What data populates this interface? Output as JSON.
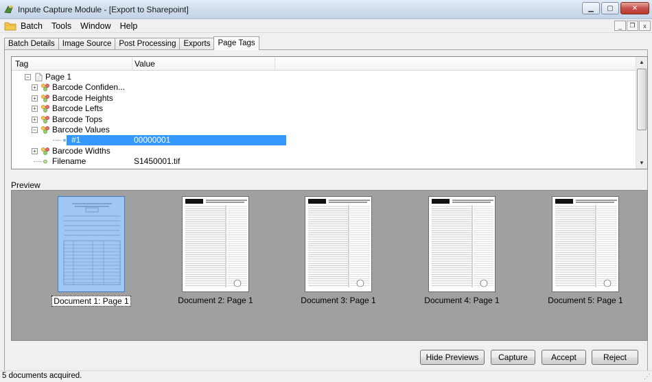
{
  "window": {
    "title": "Inpute Capture Module - [Export to Sharepoint]",
    "controls": {
      "minimize": "▁",
      "maximize": "▢",
      "close": "✕"
    }
  },
  "menu": {
    "items": [
      "Batch",
      "Tools",
      "Window",
      "Help"
    ],
    "mdi_controls": {
      "minimize": "_",
      "restore": "❐",
      "close": "x"
    }
  },
  "tabs": [
    {
      "label": "Batch Details",
      "active": false
    },
    {
      "label": "Image Source",
      "active": false
    },
    {
      "label": "Post Processing",
      "active": false
    },
    {
      "label": "Exports",
      "active": false
    },
    {
      "label": "Page Tags",
      "active": true
    }
  ],
  "tag_grid": {
    "columns": [
      "Tag",
      "Value"
    ],
    "rows": [
      {
        "tag": "Page 1",
        "value": "",
        "level": 0,
        "expander": "−",
        "icon": "page-icon"
      },
      {
        "tag": "Barcode Confiden...",
        "value": "",
        "level": 1,
        "expander": "+",
        "icon": "tag-group-icon"
      },
      {
        "tag": "Barcode Heights",
        "value": "",
        "level": 1,
        "expander": "+",
        "icon": "tag-group-icon"
      },
      {
        "tag": "Barcode Lefts",
        "value": "",
        "level": 1,
        "expander": "+",
        "icon": "tag-group-icon"
      },
      {
        "tag": "Barcode Tops",
        "value": "",
        "level": 1,
        "expander": "+",
        "icon": "tag-group-icon"
      },
      {
        "tag": "Barcode Values",
        "value": "",
        "level": 1,
        "expander": "−",
        "icon": "tag-group-icon"
      },
      {
        "tag": "#1",
        "value": "00000001",
        "level": 2,
        "expander": "",
        "icon": "value-dot-icon",
        "selected": true
      },
      {
        "tag": "Barcode Widths",
        "value": "",
        "level": 1,
        "expander": "+",
        "icon": "tag-group-icon"
      },
      {
        "tag": "Filename",
        "value": "S1450001.tif",
        "level": 1,
        "expander": "",
        "icon": "value-dot-icon"
      }
    ]
  },
  "preview": {
    "label": "Preview",
    "documents": [
      {
        "caption": "Document 1: Page 1",
        "selected": true
      },
      {
        "caption": "Document 2: Page 1",
        "selected": false
      },
      {
        "caption": "Document 3: Page 1",
        "selected": false
      },
      {
        "caption": "Document 4: Page 1",
        "selected": false
      },
      {
        "caption": "Document 5: Page 1",
        "selected": false
      }
    ]
  },
  "buttons": {
    "hide_previews": "Hide Previews",
    "capture": "Capture",
    "accept": "Accept",
    "reject": "Reject"
  },
  "status": {
    "text": "5 documents acquired."
  },
  "colors": {
    "selection": "#3399ff",
    "preview_bg": "#a0a0a0",
    "title_bar": "#cfdcec"
  }
}
